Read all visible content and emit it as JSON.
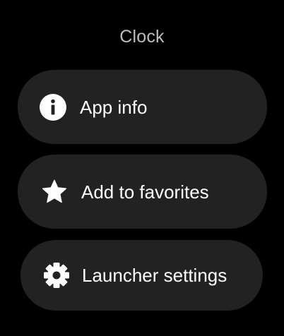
{
  "header": {
    "app_name": "Clock"
  },
  "menu": {
    "items": [
      {
        "label": "App info",
        "icon": "info-icon"
      },
      {
        "label": "Add to favorites",
        "icon": "star-icon"
      },
      {
        "label": "Launcher settings",
        "icon": "gear-icon"
      }
    ]
  },
  "colors": {
    "background": "#000000",
    "chip": "#222222",
    "text": "#ffffff",
    "title": "#bdbdbd"
  }
}
